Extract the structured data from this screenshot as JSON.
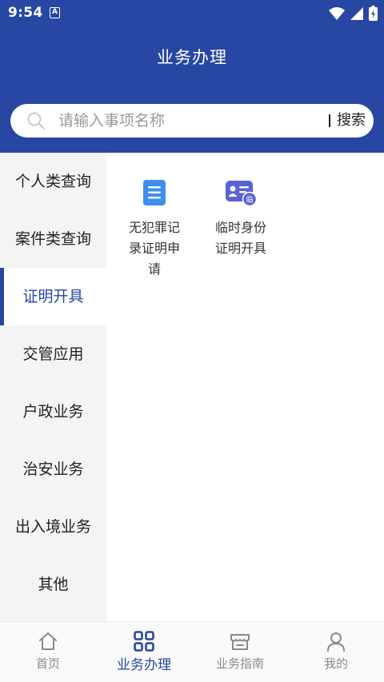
{
  "status_bar": {
    "time": "9:54",
    "badge": "A"
  },
  "header": {
    "title": "业务办理"
  },
  "search": {
    "placeholder": "请输入事项名称",
    "button_label": "搜索"
  },
  "sidebar": {
    "items": [
      {
        "label": "个人类查询"
      },
      {
        "label": "案件类查询"
      },
      {
        "label": "证明开具"
      },
      {
        "label": "交管应用"
      },
      {
        "label": "户政业务"
      },
      {
        "label": "治安业务"
      },
      {
        "label": "出入境业务"
      },
      {
        "label": "其他"
      }
    ],
    "active_index": 2
  },
  "services": [
    {
      "label": "无犯罪记录证明申请",
      "icon": "document-icon"
    },
    {
      "label": "临时身份证明开具",
      "icon": "temporary-id-icon",
      "icon_badge": "临"
    }
  ],
  "tabbar": {
    "tabs": [
      {
        "label": "首页",
        "icon": "home-icon"
      },
      {
        "label": "业务办理",
        "icon": "grid-icon"
      },
      {
        "label": "业务指南",
        "icon": "store-icon"
      },
      {
        "label": "我的",
        "icon": "user-icon"
      }
    ],
    "active_index": 1
  },
  "colors": {
    "primary": "#2847a3",
    "sidebar_bg": "#f4f4f4",
    "icon_blue": "#3d8ef0",
    "icon_violet": "#5b62d6"
  }
}
